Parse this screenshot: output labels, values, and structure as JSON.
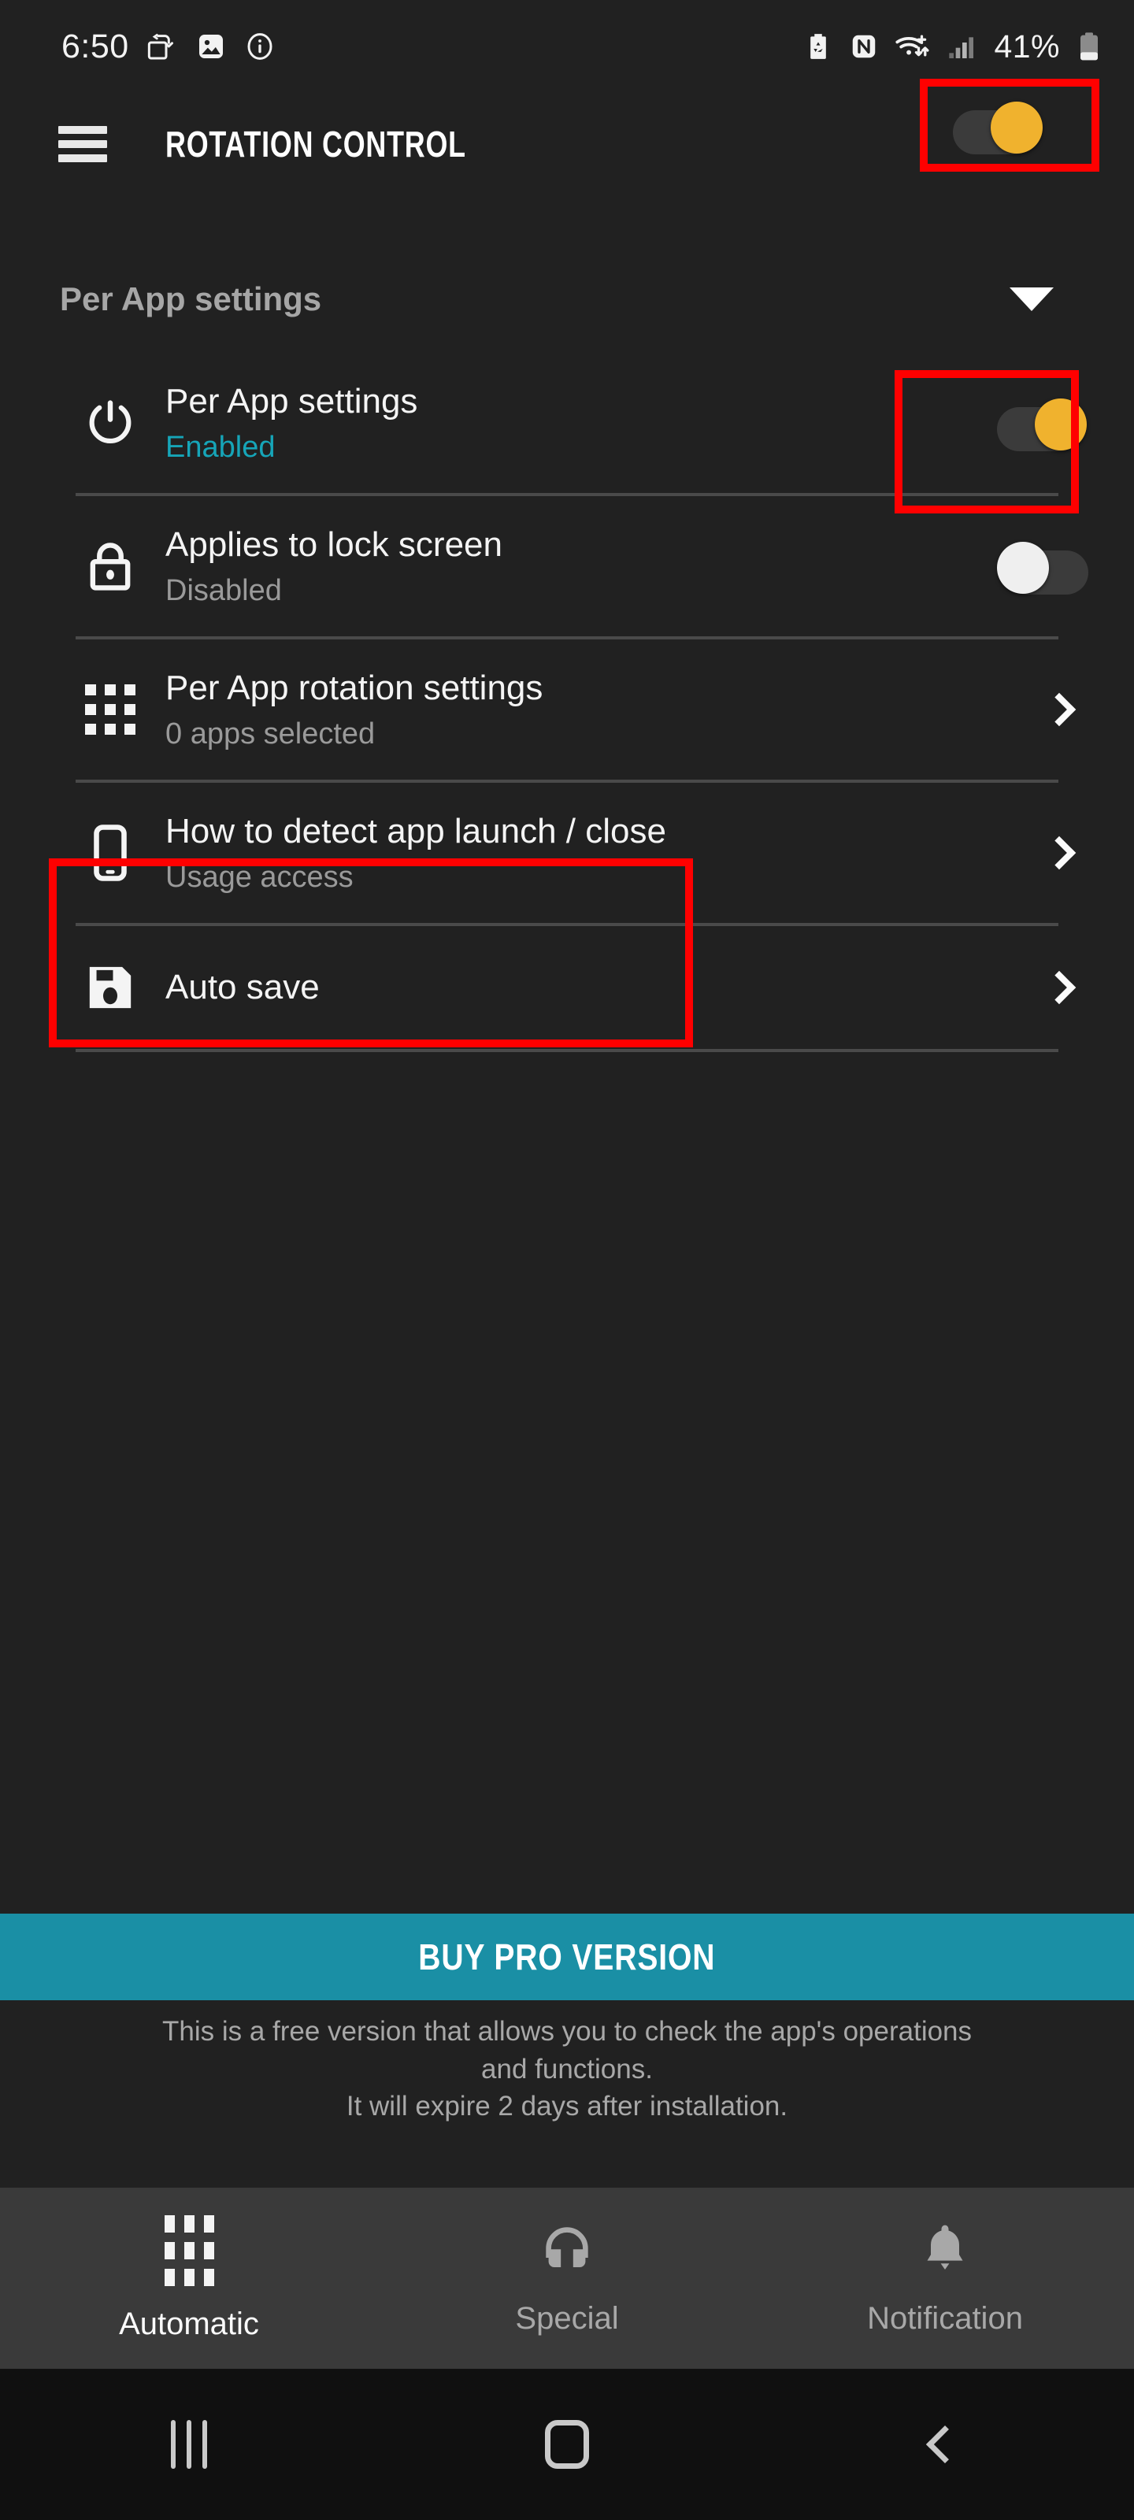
{
  "status_bar": {
    "clock": "6:50",
    "battery_percent": "41%",
    "left_icons": [
      "rotate-screen-icon",
      "gallery-icon",
      "info-icon"
    ],
    "right_icons": [
      "battery-saver-icon",
      "nfc-icon",
      "wifi-icon",
      "signal-icon",
      "battery-icon"
    ]
  },
  "app_bar": {
    "title": "ROTATION CONTROL",
    "menu_icon": "hamburger-icon",
    "master_toggle": {
      "state": "on",
      "label": "Master rotation toggle"
    }
  },
  "section": {
    "title": "Per App settings",
    "expand_icon": "caret-down-icon"
  },
  "rows": [
    {
      "icon": "power-icon",
      "title": "Per App settings",
      "subtitle": "Enabled",
      "subtitle_style": "enabled",
      "accessory": "toggle",
      "toggle_state": "on"
    },
    {
      "icon": "lock-icon",
      "title": "Applies to lock screen",
      "subtitle": "Disabled",
      "subtitle_style": "normal",
      "accessory": "toggle",
      "toggle_state": "off"
    },
    {
      "icon": "grid-icon",
      "title": "Per App rotation settings",
      "subtitle": "0 apps selected",
      "subtitle_style": "normal",
      "accessory": "chevron",
      "toggle_state": ""
    },
    {
      "icon": "phone-icon",
      "title": "How to detect app launch / close",
      "subtitle": "Usage access",
      "subtitle_style": "normal",
      "accessory": "chevron",
      "toggle_state": ""
    },
    {
      "icon": "save-icon",
      "title": "Auto save",
      "subtitle": "",
      "subtitle_style": "normal",
      "accessory": "chevron",
      "toggle_state": ""
    }
  ],
  "buy_pro": {
    "label": "BUY PRO VERSION"
  },
  "free_note": {
    "line1": "This is a free version that allows you to check the app's operations",
    "line2": "and functions.",
    "line3": "It will expire 2 days after installation."
  },
  "tabs": [
    {
      "label": "Automatic",
      "icon": "grid-icon",
      "active": true
    },
    {
      "label": "Special",
      "icon": "headphones-icon",
      "active": false
    },
    {
      "label": "Notification",
      "icon": "bell-icon",
      "active": false
    }
  ],
  "nav_bar": {
    "recent_label": "recent-apps-icon",
    "home_label": "home-icon",
    "back_label": "back-icon"
  },
  "colors": {
    "background": "#212121",
    "toggle_on": "#f0b22e",
    "toggle_off": "#efefef",
    "accent_teal": "#16a5b8",
    "banner_teal": "#1a8fa5",
    "highlight_red": "#ff0000",
    "tabbar_bg": "#3a3a3a",
    "navbar_bg": "#101010"
  }
}
